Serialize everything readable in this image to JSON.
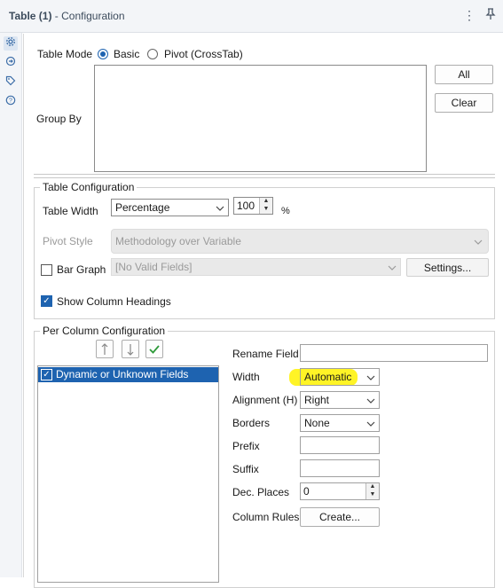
{
  "header": {
    "title_bold": "Table (1)",
    "title_rest": " - Configuration",
    "menu_icon": "more-vertical-icon",
    "pin_icon": "pin-icon"
  },
  "sidebar": {
    "icons": [
      "gear-icon",
      "connection-icon",
      "tag-icon",
      "help-icon"
    ]
  },
  "table_mode": {
    "label": "Table Mode",
    "options": [
      "Basic",
      "Pivot (CrossTab)"
    ],
    "selected": "Basic"
  },
  "group_by": {
    "label": "Group By",
    "all_button": "All",
    "clear_button": "Clear"
  },
  "table_config": {
    "title": "Table Configuration",
    "width_label": "Table Width",
    "width_value": "Percentage",
    "width_number": "100",
    "width_unit": "%",
    "pivot_style_label": "Pivot Style",
    "pivot_style_value": "Methodology over Variable",
    "bar_graph_label": "Bar Graph",
    "bar_graph_field": "[No Valid Fields]",
    "settings_button": "Settings...",
    "show_headings_label": "Show Column Headings",
    "show_headings_checked": true
  },
  "per_column": {
    "title": "Per Column Configuration",
    "list_items": [
      "Dynamic or Unknown Fields"
    ],
    "rename_label": "Rename Field",
    "rename_value": "",
    "width_label": "Width",
    "width_value": "Automatic",
    "alignment_label": "Alignment (H)",
    "alignment_value": "Right",
    "borders_label": "Borders",
    "borders_value": "None",
    "prefix_label": "Prefix",
    "prefix_value": "",
    "suffix_label": "Suffix",
    "suffix_value": "",
    "dec_places_label": "Dec. Places",
    "dec_places_value": "0",
    "column_rules_label": "Column Rules",
    "create_button": "Create...",
    "highlight_color": "#fff200"
  }
}
